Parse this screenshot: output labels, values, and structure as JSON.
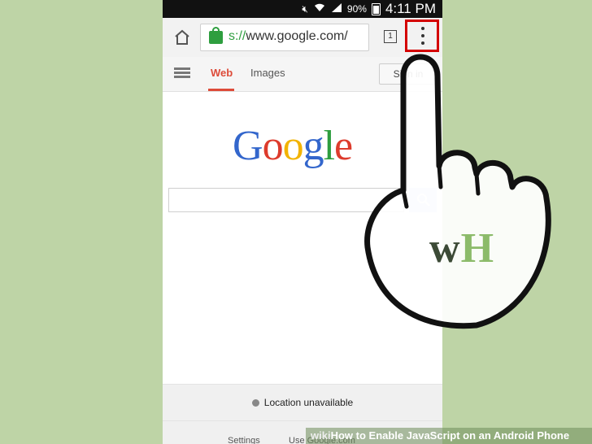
{
  "status_bar": {
    "battery": "90%",
    "time": "4:11 PM"
  },
  "browser": {
    "url_scheme": "s://",
    "url_rest": "www.google.com/",
    "tab_count": "1"
  },
  "nav": {
    "web": "Web",
    "images": "Images",
    "sign_in": "Sign in"
  },
  "logo_letters": [
    {
      "ch": "G",
      "color": "#3366cc"
    },
    {
      "ch": "o",
      "color": "#dd3b2c"
    },
    {
      "ch": "o",
      "color": "#f2b300"
    },
    {
      "ch": "g",
      "color": "#3366cc"
    },
    {
      "ch": "l",
      "color": "#2e9e3f"
    },
    {
      "ch": "e",
      "color": "#dd3b2c"
    }
  ],
  "footer": {
    "location": "Location unavailable",
    "settings": "Settings",
    "use_google": "Use Google.com"
  },
  "watermark": {
    "w": "w",
    "h": "H",
    "w_color": "#3c4a36",
    "h_color": "#8cbb6a"
  },
  "caption": {
    "wiki": "wiki",
    "how": "How",
    "rest": " to Enable JavaScript on an Android Phone"
  },
  "colors": {
    "background": "#bed4a6",
    "highlight": "#d40000",
    "link_red": "#dd4b39"
  }
}
